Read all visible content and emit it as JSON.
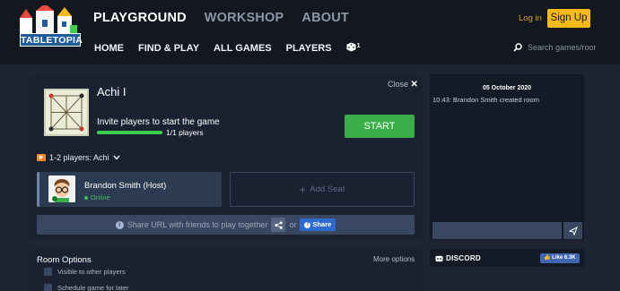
{
  "brand": {
    "logo_text": "TABLETOPIA"
  },
  "main_nav": [
    {
      "label": "PLAYGROUND",
      "active": true
    },
    {
      "label": "WORKSHOP",
      "active": false
    },
    {
      "label": "ABOUT",
      "active": false
    }
  ],
  "sub_nav": {
    "home": "HOME",
    "find_play": "FIND & PLAY",
    "all_games": "ALL GAMES",
    "players": "PLAYERS",
    "dice_count": "1"
  },
  "auth": {
    "login": "Log in",
    "signup": "Sign Up"
  },
  "search": {
    "placeholder": "Search games/rooms"
  },
  "room": {
    "game_title": "Achi I",
    "close_label": "Close",
    "invite_text": "Invite players to start the game",
    "players_count": "1/1 players",
    "progress": 1.0,
    "start_label": "START",
    "players_select": "1-2 players: Achi",
    "player": {
      "name": "Brandon Smith (Host)",
      "status": "Online"
    },
    "add_seat": "Add Seat",
    "share_text": "Share URL with friends to play together",
    "or_text": "or",
    "share_button": "Share"
  },
  "chat": {
    "date": "05 October 2020",
    "messages": [
      "10:43: Brandon Smith created room"
    ],
    "input_value": ""
  },
  "options": {
    "title": "Room Options",
    "more": "More options",
    "items": [
      "Visible to other players",
      "Schedule game for later"
    ]
  },
  "social": {
    "discord": "DISCORD",
    "fb_like": "Like 6.3K"
  },
  "colors": {
    "accent_green": "#3aae48",
    "signup_yellow": "#f7b81a",
    "online_green": "#40c057",
    "facebook_blue": "#2f6ad0"
  }
}
